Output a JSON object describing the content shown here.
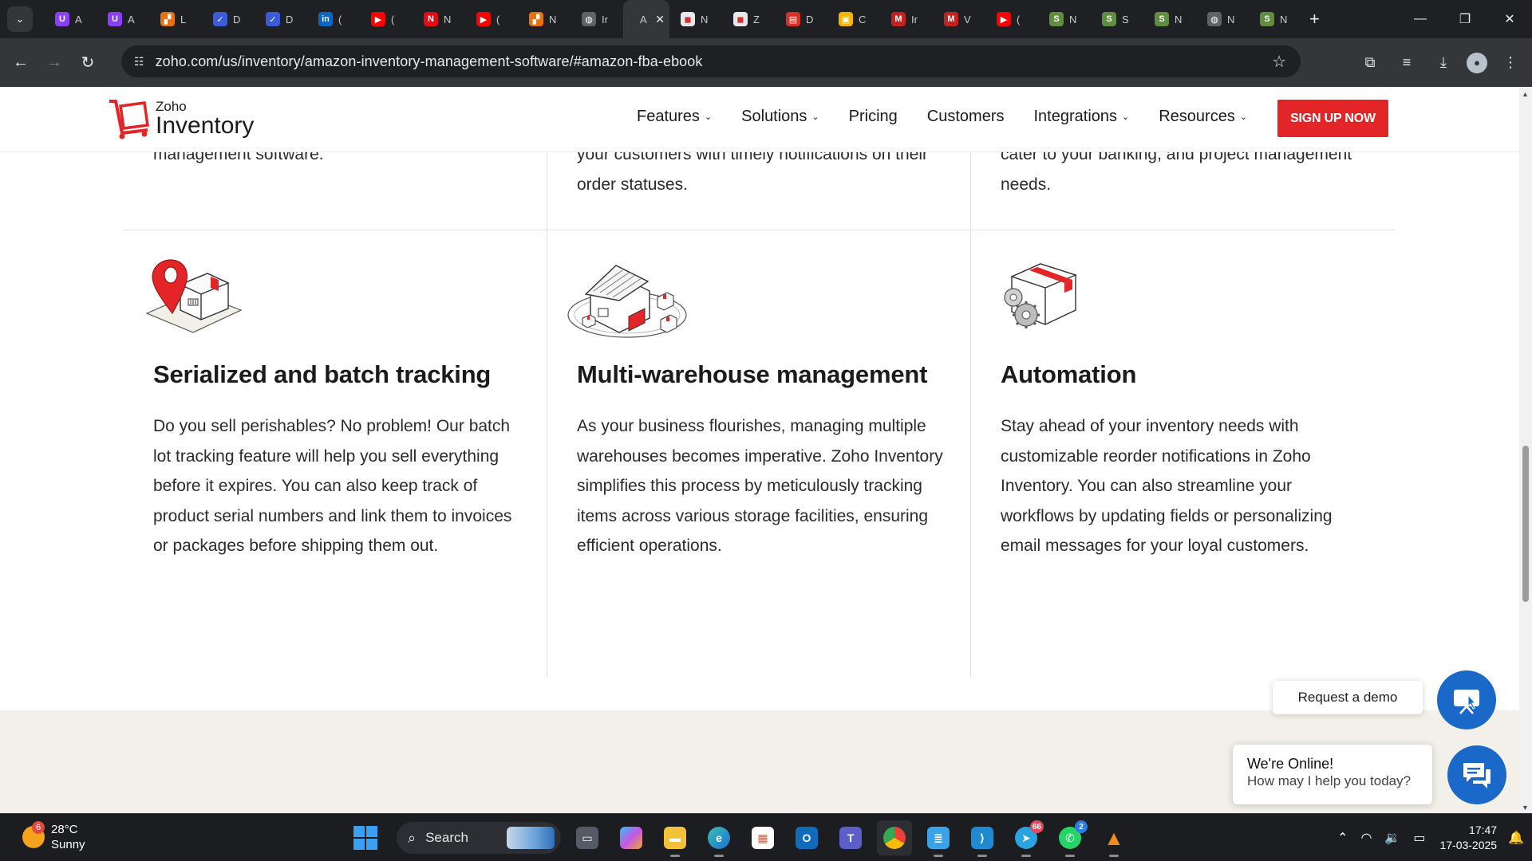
{
  "browser": {
    "tabs": [
      {
        "title": "A",
        "fav": "U",
        "color": "#8a3ffc"
      },
      {
        "title": "A",
        "fav": "U",
        "color": "#8a3ffc"
      },
      {
        "title": "L",
        "fav": "▞",
        "color": "#e8710a"
      },
      {
        "title": "D",
        "fav": "✓",
        "color": "#3b5bdb"
      },
      {
        "title": "D",
        "fav": "✓",
        "color": "#3b5bdb"
      },
      {
        "title": "(",
        "fav": "in",
        "color": "#0a66c2"
      },
      {
        "title": "(",
        "fav": "▶",
        "color": "#ff0000"
      },
      {
        "title": "N",
        "fav": "N",
        "color": "#e50914"
      },
      {
        "title": "(",
        "fav": "▶",
        "color": "#ff0000"
      },
      {
        "title": "N",
        "fav": "▞",
        "color": "#e8710a"
      },
      {
        "title": "Ir",
        "fav": "◍",
        "color": "#5f6368"
      },
      {
        "title": "A",
        "fav": "",
        "color": "#35363a"
      },
      {
        "title": "N",
        "fav": "◼",
        "color": "#e8e8e8"
      },
      {
        "title": "Z",
        "fav": "◼",
        "color": "#e8e8e8"
      },
      {
        "title": "D",
        "fav": "▤",
        "color": "#d93025"
      },
      {
        "title": "C",
        "fav": "▣",
        "color": "#f4b400"
      },
      {
        "title": "Ir",
        "fav": "M",
        "color": "#c5221f"
      },
      {
        "title": "V",
        "fav": "M",
        "color": "#c5221f"
      },
      {
        "title": "(",
        "fav": "▶",
        "color": "#ff0000"
      },
      {
        "title": "N",
        "fav": "S",
        "color": "#5e8e3e"
      },
      {
        "title": "S",
        "fav": "S",
        "color": "#5e8e3e"
      },
      {
        "title": "N",
        "fav": "S",
        "color": "#5e8e3e"
      },
      {
        "title": "N",
        "fav": "◍",
        "color": "#5f6368"
      },
      {
        "title": "N",
        "fav": "S",
        "color": "#5e8e3e"
      }
    ],
    "url": "zoho.com/us/inventory/amazon-inventory-management-software/#amazon-fba-ebook"
  },
  "site": {
    "logo_top": "Zoho",
    "logo_bottom": "Inventory",
    "nav": [
      {
        "label": "Features",
        "dropdown": true
      },
      {
        "label": "Solutions",
        "dropdown": true
      },
      {
        "label": "Pricing",
        "dropdown": false
      },
      {
        "label": "Customers",
        "dropdown": false
      },
      {
        "label": "Integrations",
        "dropdown": true
      },
      {
        "label": "Resources",
        "dropdown": true
      }
    ],
    "signup": "SIGN UP NOW"
  },
  "top_row": {
    "col1_line1": "management software.",
    "col2_line1": "your customers with timely notifications on their",
    "col2_line2": "order statuses.",
    "col3_line1": "cater to your banking, and project management",
    "col3_line2": "needs."
  },
  "features": [
    {
      "title": "Serialized and batch tracking",
      "desc": "Do you sell perishables? No problem! Our batch lot tracking feature will help you sell everything before it expires. You can also keep track of product serial numbers and link them to invoices or packages before shipping them out."
    },
    {
      "title": "Multi-warehouse management",
      "desc": "As your business flourishes, managing multiple warehouses becomes imperative. Zoho Inventory simplifies this process by meticulously tracking items across various storage facilities, ensuring efficient operations."
    },
    {
      "title": "Automation",
      "desc": "Stay ahead of your inventory needs with customizable reorder notifications in Zoho Inventory. You can also streamline your workflows by updating fields or personalizing email messages for your loyal customers."
    }
  ],
  "widgets": {
    "demo": "Request a demo",
    "chat_title": "We're Online!",
    "chat_sub": "How may I help you today?"
  },
  "taskbar": {
    "weather_badge": "6",
    "temp": "28°C",
    "condition": "Sunny",
    "search": "Search",
    "telegram_badge": "66",
    "whatsapp_badge": "2",
    "time": "17:47",
    "date": "17-03-2025"
  },
  "colors": {
    "brand_red": "#e42527",
    "chat_blue": "#1a69c9"
  }
}
